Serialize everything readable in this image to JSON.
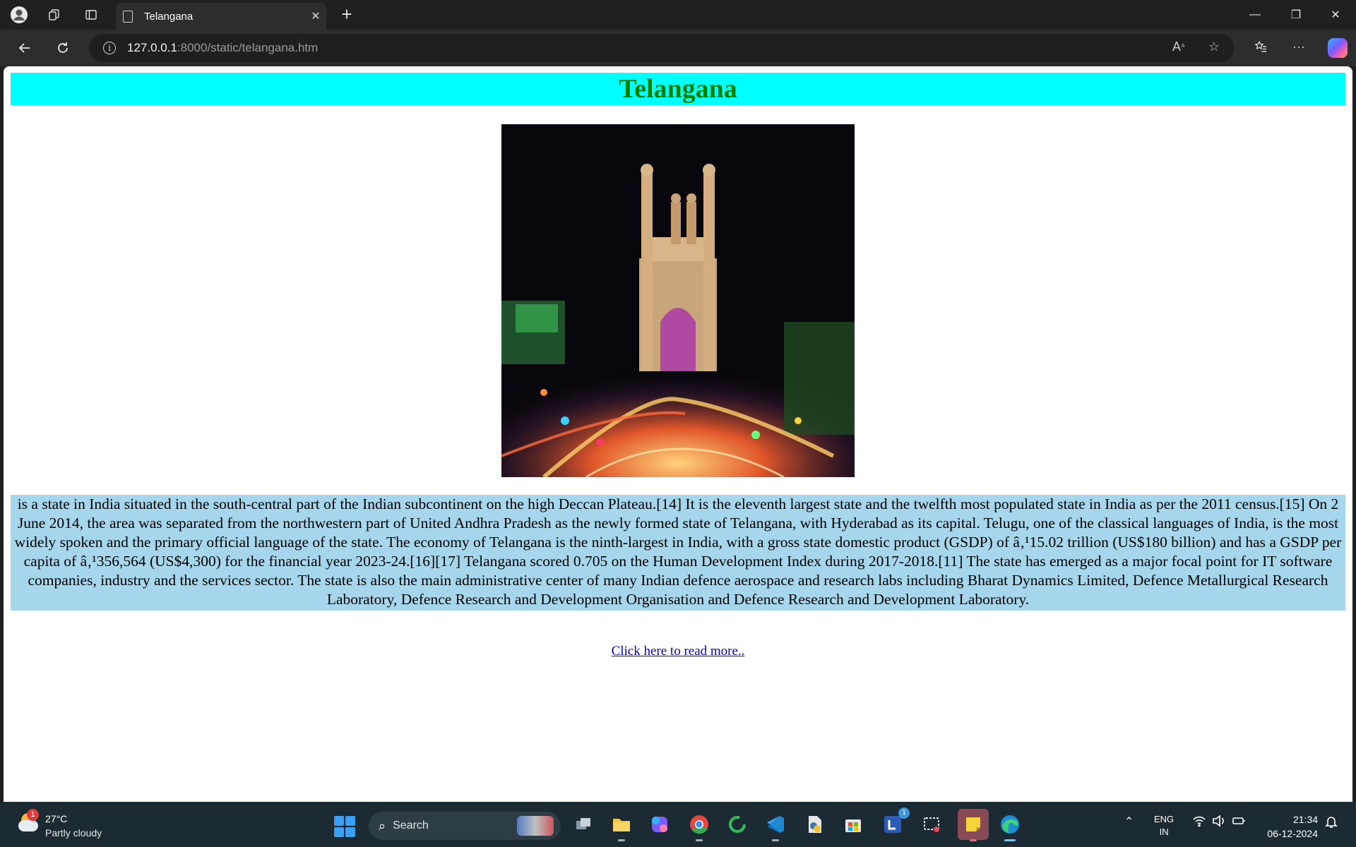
{
  "browser": {
    "tab_title": "Telangana",
    "url_host": "127.0.0.1",
    "url_rest": ":8000/static/telangana.htm"
  },
  "page": {
    "heading": "Telangana",
    "heading_color": "#008000",
    "heading_background": "#00ffff",
    "description_background": "#a6d6ec",
    "description": " is a state in India situated in the south-central part of the Indian subcontinent on the high Deccan Plateau.[14] It is the eleventh largest state and the twelfth most populated state in India as per the 2011 census.[15] On 2 June 2014, the area was separated from the northwestern part of United Andhra Pradesh as the newly formed state of Telangana, with Hyderabad as its capital. Telugu, one of the classical languages of India, is the most widely spoken and the primary official language of the state. The economy of Telangana is the ninth-largest in India, with a gross state domestic product (GSDP) of â‚¹15.02 trillion (US$180 billion) and has a GSDP per capita of â‚¹356,564 (US$4,300) for the financial year 2023-24.[16][17] Telangana scored 0.705 on the Human Development Index during 2017-2018.[11] The state has emerged as a major focal point for IT software companies, industry and the services sector. The state is also the main administrative center of many Indian defence aerospace and research labs including Bharat Dynamics Limited, Defence Metallurgical Research Laboratory, Defence Research and Development Organisation and Defence Research and Development Laboratory.",
    "read_more": "Click here to read more..",
    "image_subject": "charminar-night-photo"
  },
  "taskbar": {
    "weather_temp": "27°C",
    "weather_desc": "Partly cloudy",
    "weather_badge": "1",
    "search_label": "Search",
    "outlook_badge": "1",
    "lang_top": "ENG",
    "lang_bottom": "IN",
    "time": "21:34",
    "date": "06-12-2024"
  }
}
